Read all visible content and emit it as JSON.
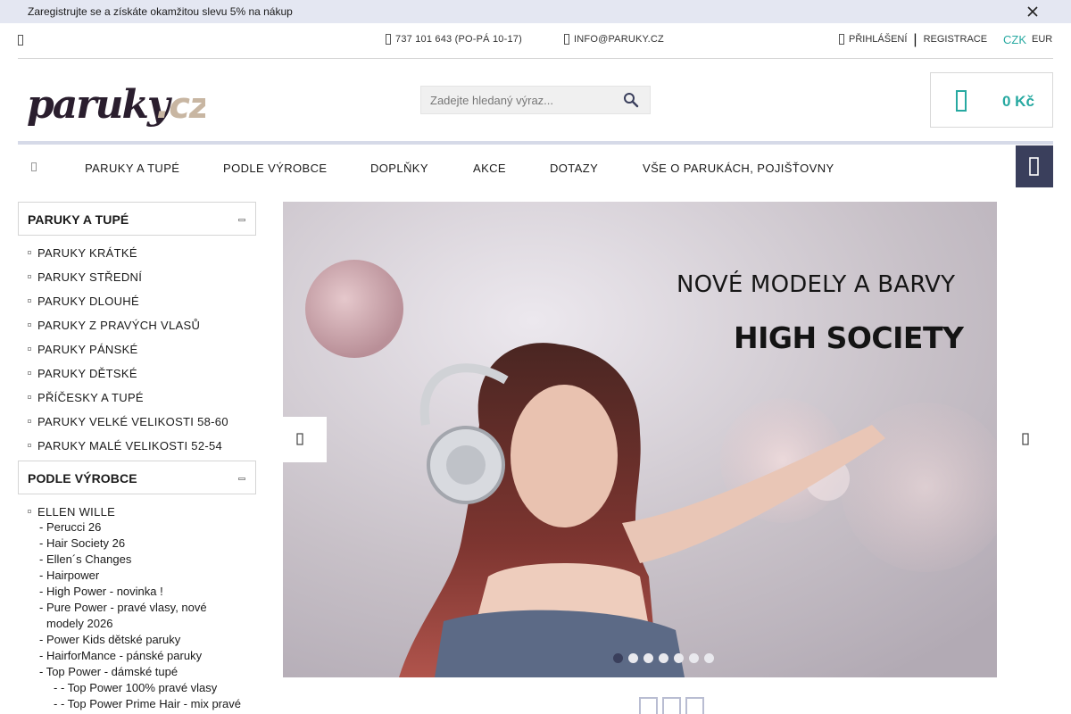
{
  "promo": {
    "text": "Zaregistrujte se a získáte okamžitou slevu 5% na nákup"
  },
  "topbar": {
    "phone": "737 101 643 (PO-PÁ 10-17)",
    "email": "INFO@PARUKY.CZ",
    "login": "PŘIHLÁŠENÍ",
    "separator": "|",
    "register": "REGISTRACE",
    "currency_active": "CZK",
    "currency_other": "EUR"
  },
  "header": {
    "logo_text_main": "paruky",
    "logo_text_tld": ".cz",
    "search_placeholder": "Zadejte hledaný výraz...",
    "cart_price": "0 Kč"
  },
  "nav": {
    "items": [
      "PARUKY A TUPÉ",
      "PODLE VÝROBCE",
      "DOPLŇKY",
      "AKCE",
      "DOTAZY",
      "VŠE O PARUKÁCH, POJIŠŤOVNY"
    ]
  },
  "sidebar": {
    "section1": {
      "title": "PARUKY A TUPÉ",
      "items": [
        "PARUKY KRÁTKÉ",
        "PARUKY STŘEDNÍ",
        "PARUKY DLOUHÉ",
        "PARUKY Z PRAVÝCH VLASŮ",
        "PARUKY PÁNSKÉ",
        "PARUKY DĚTSKÉ",
        "PŘÍČESKY A TUPÉ",
        "PARUKY VELKÉ VELIKOSTI 58-60",
        "PARUKY MALÉ VELIKOSTI 52-54"
      ]
    },
    "section2": {
      "title": "PODLE VÝROBCE",
      "brand": "ELLEN WILLE",
      "subs": [
        "- Perucci 26",
        "- Hair Society 26",
        "- Ellen´s Changes",
        "- Hairpower",
        "- High Power - novinka !",
        "- Pure Power - pravé vlasy, nové modely 2026",
        "- Power Kids dětské paruky",
        "- HairforMance - pánské paruky",
        "- Top Power - dámské tupé"
      ],
      "subsubs": [
        "- - Top Power 100% pravé vlasy",
        "- - Top Power Prime Hair - mix pravé vlasy a syntetické vlákno"
      ]
    }
  },
  "slider": {
    "line1": "NOVÉ MODELY A BARVY",
    "line2": "HIGH SOCIETY",
    "dot_count": 7,
    "active_dot": 0
  },
  "colors": {
    "accent": "#27a9a1",
    "dark": "#3a3f5c",
    "logo_dark": "#2a1e2e",
    "logo_tld": "#c8b6a2"
  }
}
